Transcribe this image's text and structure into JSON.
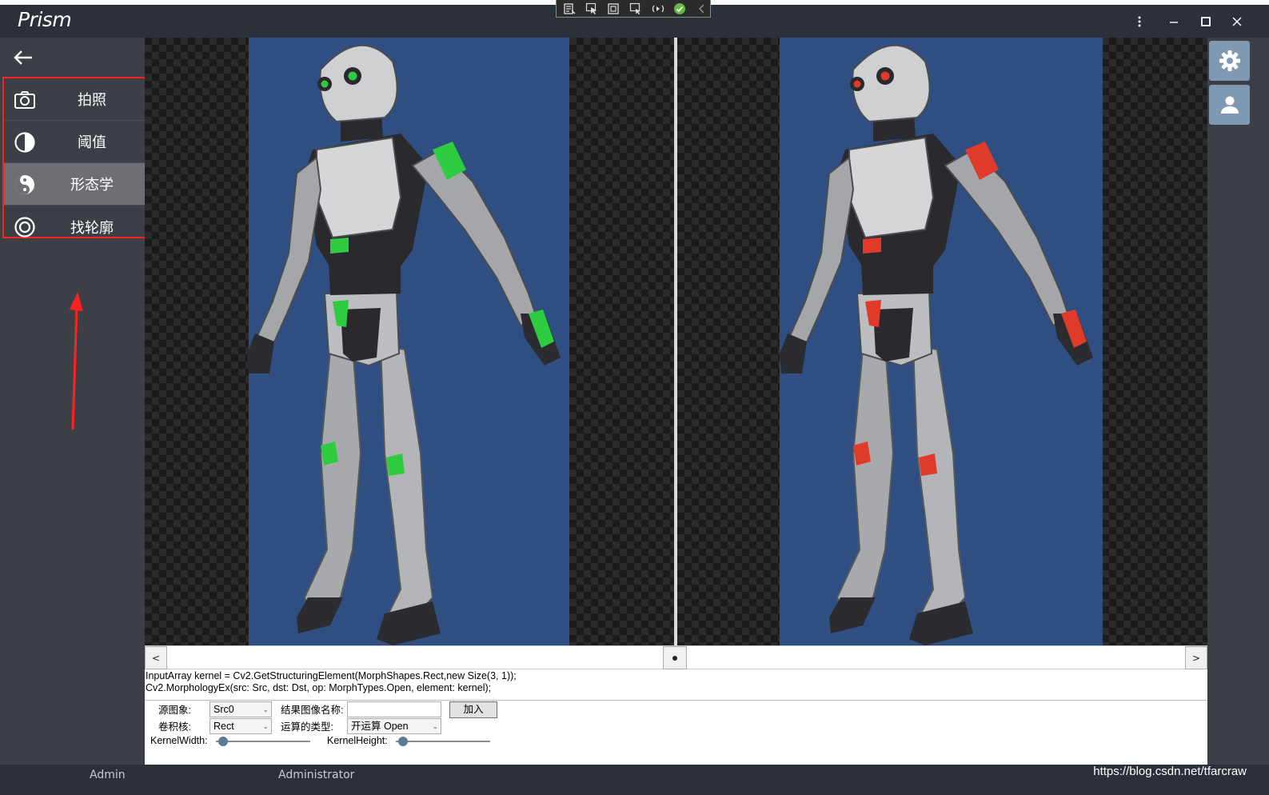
{
  "app": {
    "title": "Prism"
  },
  "nav": {
    "items": [
      {
        "label": "拍照",
        "icon": "camera-icon"
      },
      {
        "label": "阈值",
        "icon": "contrast-icon"
      },
      {
        "label": "形态学",
        "icon": "yin-yang-icon",
        "active": true
      },
      {
        "label": "找轮廓",
        "icon": "target-icon"
      }
    ]
  },
  "viewer": {
    "left_image": {
      "accent_color": "#2ecc40"
    },
    "right_image": {
      "accent_color": "#e03a2a"
    },
    "scroll_prev": "<",
    "scroll_next": ">"
  },
  "code": {
    "line1": "InputArray kernel = Cv2.GetStructuringElement(MorphShapes.Rect,new Size(3, 1));",
    "line2": "Cv2.MorphologyEx(src: Src, dst: Dst, op: MorphTypes.Open, element: kernel);"
  },
  "form": {
    "source_label": "源图象:",
    "source_value": "Src0",
    "result_name_label": "结果图像名称:",
    "result_name_value": "",
    "add_button": "加入",
    "kernel_label": "卷积核:",
    "kernel_value": "Rect",
    "op_label": "运算的类型:",
    "op_value": "开运算 Open",
    "kernel_width_label": "KernelWidth:",
    "kernel_height_label": "KernelHeight:"
  },
  "status": {
    "user": "Admin",
    "role": "Administrator",
    "watermark": "https://blog.csdn.net/tfarcraw"
  },
  "colors": {
    "chrome": "#2c3139",
    "nav_bg": "#3c3f46",
    "highlight_border": "#ff2020",
    "rail_button": "#7f99b3"
  }
}
